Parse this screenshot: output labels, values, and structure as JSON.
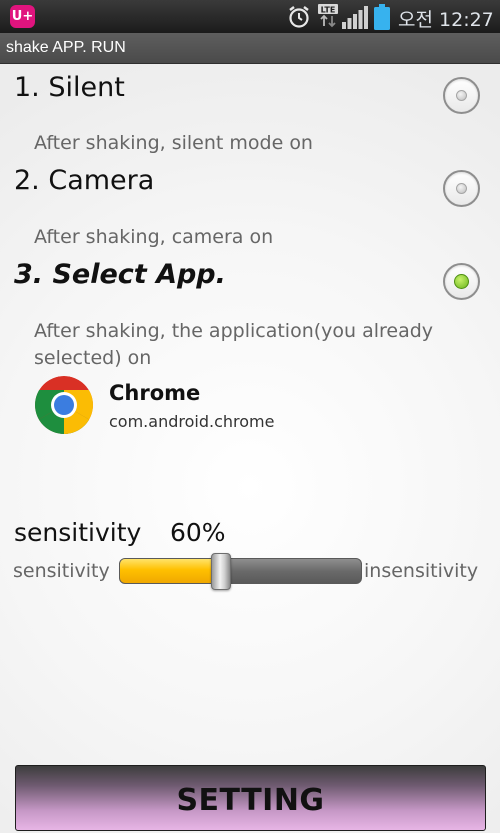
{
  "status_bar": {
    "carrier_logo": "U+",
    "network_badge": "LTE",
    "ampm": "오전",
    "time": "12:27",
    "icons": [
      "alarm-clock-icon",
      "lte-icon",
      "signal-strength-icon",
      "battery-icon"
    ]
  },
  "app_bar": {
    "title": "shake APP. RUN"
  },
  "options": [
    {
      "title": "1. Silent",
      "description": "After shaking, silent mode on",
      "selected": false
    },
    {
      "title": "2. Camera",
      "description": "After shaking, camera on",
      "selected": false
    },
    {
      "title": "3. Select App.",
      "description": "After shaking, the application(you already selected) on",
      "selected": true
    }
  ],
  "selected_app": {
    "name": "Chrome",
    "package": "com.android.chrome",
    "icon": "chrome-icon"
  },
  "sensitivity": {
    "label": "sensitivity",
    "value_text": "60%",
    "value_fraction": 0.42,
    "min_label": "sensitivity",
    "max_label": "insensitivity"
  },
  "setting_button": {
    "label": "SETTING"
  },
  "colors": {
    "accent_yellow": "#ffc000",
    "radio_checked": "#6bb51d",
    "button_gradient_end": "#e7b5e5",
    "carrier_pink": "#e0147e"
  }
}
